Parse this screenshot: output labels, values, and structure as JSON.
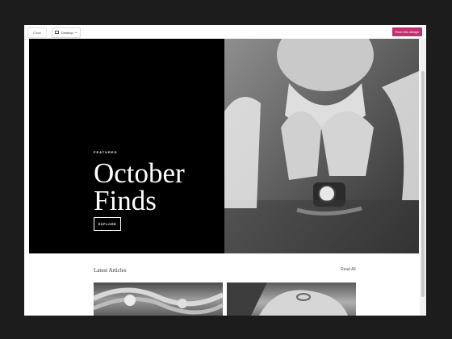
{
  "toolbar": {
    "close_label": "Close",
    "device_label": "Desktop",
    "push_label": "Push this design"
  },
  "hero": {
    "eyebrow": "FEATURED",
    "title": "October Finds",
    "button_label": "EXPLORE",
    "image_alt": "Black-and-white photo of a woman resting her chin on clasped hands, wearing a wristwatch and bracelet"
  },
  "articles": {
    "heading": "Latest Articles",
    "read_all": "Read All",
    "cards": [
      {
        "image": "Ornate silver bracelets"
      },
      {
        "image": "Hand wearing a ring"
      }
    ]
  }
}
